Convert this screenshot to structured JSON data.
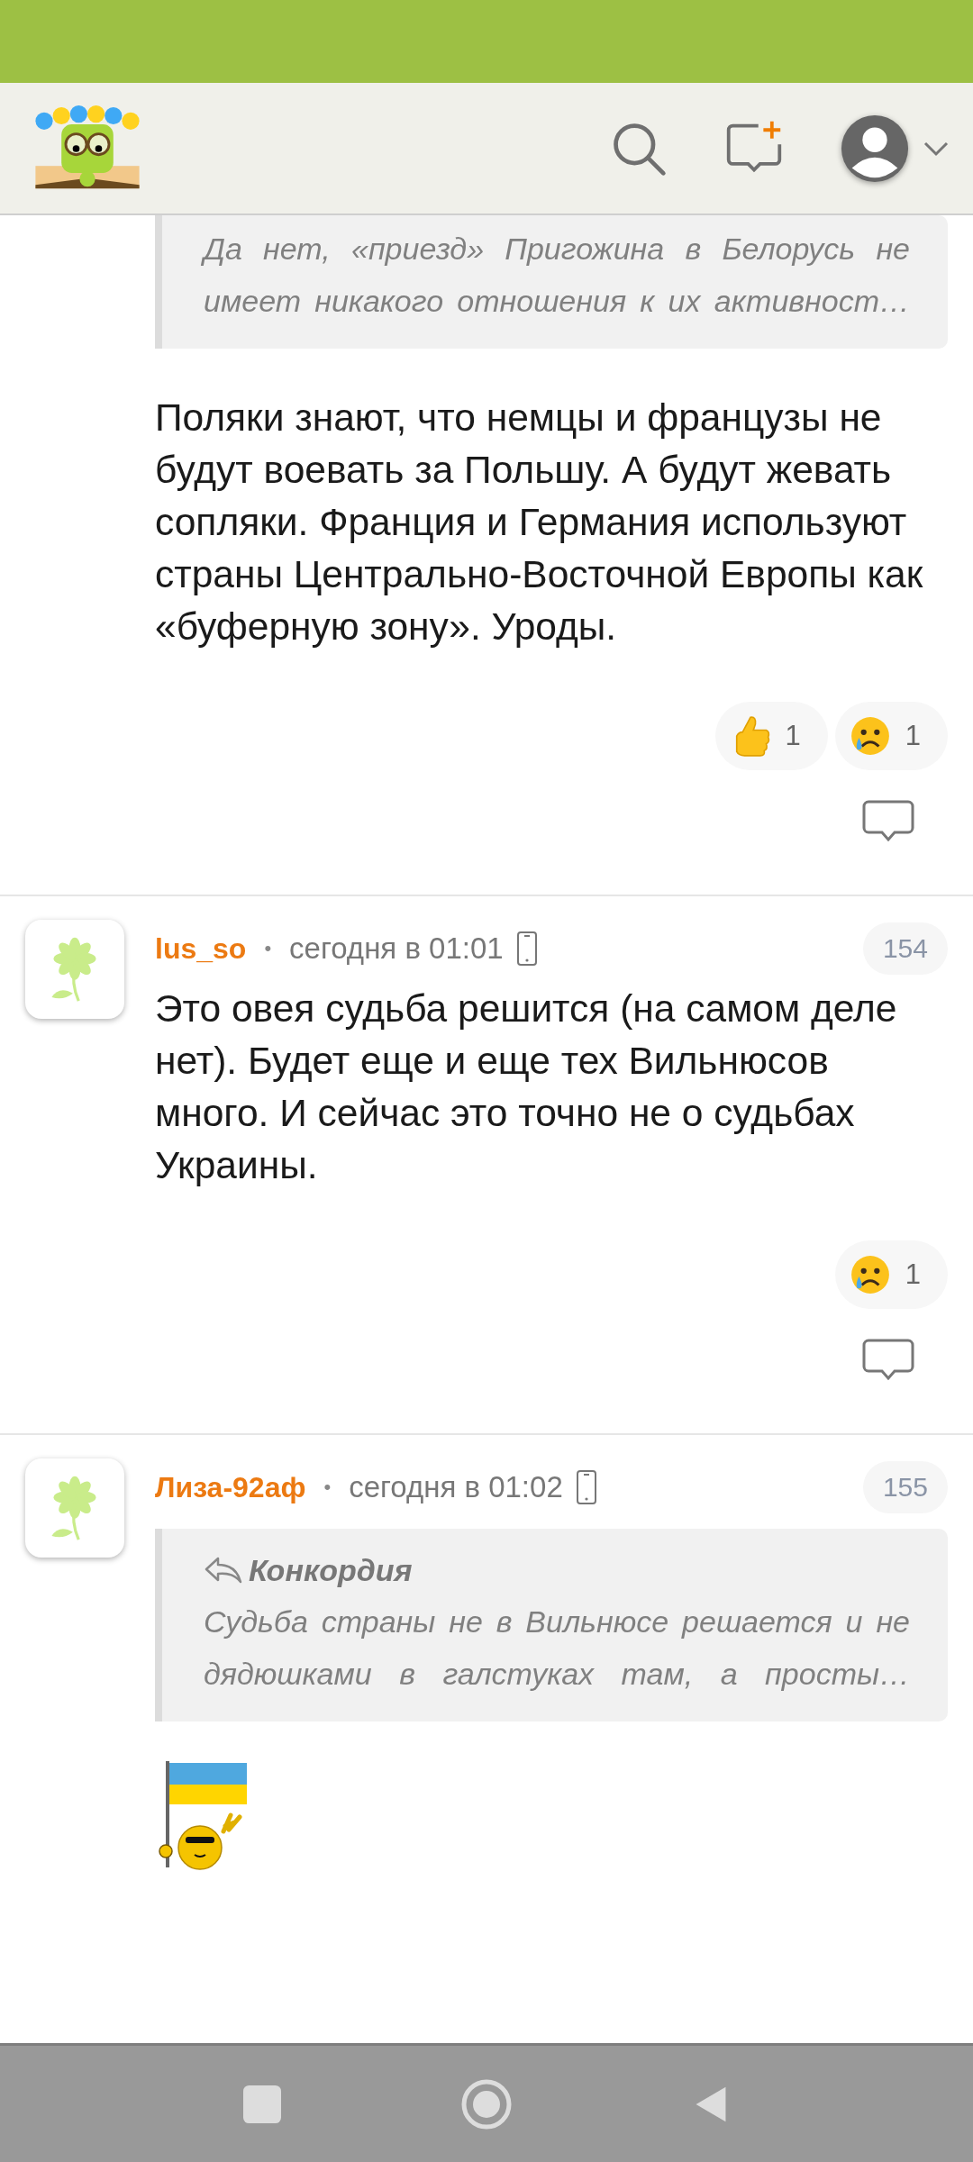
{
  "comments": [
    {
      "kind": "continuation",
      "quote": {
        "lines": [
          "Да нет, «приезд» Пригожина в Белорусь не",
          "имеет никакого отношения к их активност…"
        ]
      },
      "text": "Поляки знают, что немцы и французы не будут воевать за Польшу. А будут жевать сопляки. Франция и Германия используют страны Центрально-Восточной Европы как «буферную зону». Уроды.",
      "reactions": [
        {
          "kind": "thumbs_up",
          "count": "1"
        },
        {
          "kind": "crying",
          "count": "1"
        }
      ]
    },
    {
      "kind": "full",
      "author": "lus_so",
      "separator": "•",
      "time": "сегодня в 01:01",
      "number": "154",
      "text": "Это овея судьба решится (на самом деле нет). Будет еще и еще тех Вильнюсов много. И сейчас это точно не о судьбах Украины.",
      "reactions": [
        {
          "kind": "crying",
          "count": "1"
        }
      ]
    },
    {
      "kind": "full",
      "author": "Лиза-92аф",
      "separator": "•",
      "time": "сегодня в 01:02",
      "number": "155",
      "quote": {
        "author": "Конкордия",
        "lines": [
          "Судьба страны не в Вильнюсе решается и не",
          "дядюшками в галстуках там, а просты…"
        ]
      },
      "sticker": {
        "kind": "flag_smiley"
      }
    }
  ]
}
